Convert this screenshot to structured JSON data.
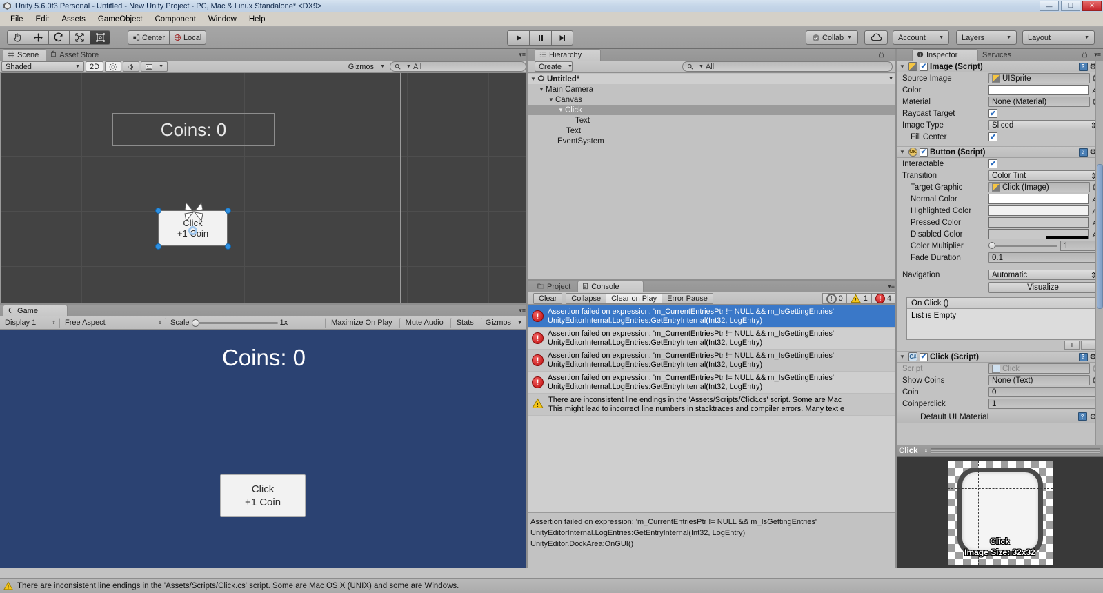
{
  "window": {
    "title": "Unity 5.6.0f3 Personal - Untitled - New Unity Project - PC, Mac & Linux Standalone* <DX9>",
    "app_icon": "unity-icon",
    "minimize": "—",
    "maximize": "❐",
    "close": "✕"
  },
  "menubar": {
    "items": [
      "File",
      "Edit",
      "Assets",
      "GameObject",
      "Component",
      "Window",
      "Help"
    ]
  },
  "toolbar": {
    "tools": [
      {
        "name": "hand-tool",
        "icon": "hand-icon",
        "active": false
      },
      {
        "name": "move-tool",
        "icon": "move-icon",
        "active": false
      },
      {
        "name": "rotate-tool",
        "icon": "rotate-icon",
        "active": false
      },
      {
        "name": "scale-tool",
        "icon": "scale-icon",
        "active": false
      },
      {
        "name": "rect-tool",
        "icon": "rect-transform-icon",
        "active": true
      }
    ],
    "pivot_label": "Center",
    "space_label": "Local",
    "play_label": "▶",
    "pause_label": "❙❙",
    "step_label": "▶❙",
    "collab_label": "Collab",
    "cloud_label": "cloud-icon",
    "account_label": "Account",
    "layers_label": "Layers",
    "layout_label": "Layout"
  },
  "scene": {
    "tabs": [
      {
        "label": "Scene",
        "icon": "scene-grid-icon",
        "active": true
      },
      {
        "label": "Asset Store",
        "icon": "store-icon",
        "active": false
      }
    ],
    "draw_mode": "Shaded",
    "mode_2d": "2D",
    "lighting_icon": "sun-icon",
    "audio_icon": "speaker-icon",
    "fx_icon": "image-icon",
    "gizmos_label": "Gizmos",
    "search_placeholder": "All",
    "search_value": "",
    "coins_text": "Coins: 0",
    "button_line1": "Click",
    "button_line2": "+1 Coin"
  },
  "game": {
    "tab_label": "Game",
    "tab_icon": "game-pad-icon",
    "display_label": "Display 1",
    "aspect_label": "Free Aspect",
    "scale_label": "Scale",
    "scale_value": "1x",
    "maximize_label": "Maximize On Play",
    "mute_label": "Mute Audio",
    "stats_label": "Stats",
    "gizmos_label": "Gizmos",
    "coins_text": "Coins: 0",
    "button_line1": "Click",
    "button_line2": "+1 Coin",
    "background_color": "#2b4272"
  },
  "hierarchy": {
    "tab_label": "Hierarchy",
    "tab_icon": "hierarchy-icon",
    "create_label": "Create",
    "search_placeholder": "All",
    "search_value": "",
    "lock_icon": "lock-icon",
    "menu_icon": "panel-menu-icon",
    "items": [
      {
        "label": "Untitled*",
        "depth": 0,
        "foldout": "▼",
        "root": true,
        "selected": false,
        "icon": "unity-scene-icon"
      },
      {
        "label": "Main Camera",
        "depth": 1,
        "foldout": "▼",
        "root": false,
        "selected": false
      },
      {
        "label": "Canvas",
        "depth": 2,
        "foldout": "▼",
        "root": false,
        "selected": false
      },
      {
        "label": "Click",
        "depth": 3,
        "foldout": "▼",
        "root": false,
        "selected": true
      },
      {
        "label": "Text",
        "depth": 4,
        "foldout": "",
        "root": false,
        "selected": false
      },
      {
        "label": "Text",
        "depth": 3,
        "foldout": "",
        "root": false,
        "selected": false
      },
      {
        "label": "EventSystem",
        "depth": 2,
        "foldout": "",
        "root": false,
        "selected": false
      }
    ]
  },
  "console": {
    "tabs": [
      {
        "label": "Project",
        "icon": "folder-icon",
        "active": false
      },
      {
        "label": "Console",
        "icon": "console-icon",
        "active": true
      }
    ],
    "buttons": [
      "Clear",
      "Collapse",
      "Clear on Play",
      "Error Pause"
    ],
    "counters": [
      {
        "type": "info",
        "icon": "info-icon",
        "count": "0"
      },
      {
        "type": "warning",
        "icon": "warning-icon",
        "count": "1"
      },
      {
        "type": "error",
        "icon": "error-icon",
        "count": "4"
      }
    ],
    "entries": [
      {
        "type": "error",
        "line1": "Assertion failed on expression: 'm_CurrentEntriesPtr != NULL && m_IsGettingEntries'",
        "line2": "UnityEditorInternal.LogEntries:GetEntryInternal(Int32, LogEntry)",
        "selected": true
      },
      {
        "type": "error",
        "line1": "Assertion failed on expression: 'm_CurrentEntriesPtr != NULL && m_IsGettingEntries'",
        "line2": "UnityEditorInternal.LogEntries:GetEntryInternal(Int32, LogEntry)",
        "selected": false
      },
      {
        "type": "error",
        "line1": "Assertion failed on expression: 'm_CurrentEntriesPtr != NULL && m_IsGettingEntries'",
        "line2": "UnityEditorInternal.LogEntries:GetEntryInternal(Int32, LogEntry)",
        "selected": false
      },
      {
        "type": "error",
        "line1": "Assertion failed on expression: 'm_CurrentEntriesPtr != NULL && m_IsGettingEntries'",
        "line2": "UnityEditorInternal.LogEntries:GetEntryInternal(Int32, LogEntry)",
        "selected": false
      },
      {
        "type": "warning",
        "line1": "There are inconsistent line endings in the 'Assets/Scripts/Click.cs' script. Some are Mac ",
        "line2": "This might lead to incorrect line numbers in stacktraces and compiler errors. Many text e",
        "selected": false
      }
    ],
    "detail": "Assertion failed on expression: 'm_CurrentEntriesPtr != NULL && m_IsGettingEntries'\nUnityEditorInternal.LogEntries:GetEntryInternal(Int32, LogEntry)\nUnityEditor.DockArea:OnGUI()"
  },
  "inspector": {
    "tabs": [
      {
        "label": "Inspector",
        "icon": "info-circle-icon",
        "active": true
      },
      {
        "label": "Services",
        "icon": "services-icon",
        "active": false
      }
    ],
    "lock_icon": "lock-icon",
    "menu_icon": "panel-menu-icon",
    "components": [
      {
        "title": "Image (Script)",
        "icon": "image-component-icon",
        "enabled": true,
        "rows": [
          {
            "label": "Source Image",
            "type": "object",
            "value": "UISprite"
          },
          {
            "label": "Color",
            "type": "color",
            "value": "#FFFFFF"
          },
          {
            "label": "Material",
            "type": "object",
            "value": "None (Material)"
          },
          {
            "label": "Raycast Target",
            "type": "checkbox",
            "value": true
          },
          {
            "label": "Image Type",
            "type": "popup",
            "value": "Sliced"
          },
          {
            "label": "Fill Center",
            "type": "checkbox",
            "value": true,
            "indent": true
          }
        ]
      },
      {
        "title": "Button (Script)",
        "icon": "ok-icon",
        "enabled": true,
        "rows": [
          {
            "label": "Interactable",
            "type": "checkbox",
            "value": true
          },
          {
            "label": "Transition",
            "type": "popup",
            "value": "Color Tint"
          },
          {
            "label": "Target Graphic",
            "type": "object",
            "value": "Click (Image)",
            "indent": true
          },
          {
            "label": "Normal Color",
            "type": "color",
            "value": "#FFFFFF",
            "indent": true
          },
          {
            "label": "Highlighted Color",
            "type": "color",
            "value": "#F5F5F5",
            "indent": true
          },
          {
            "label": "Pressed Color",
            "type": "color",
            "value": "#C8C8C8",
            "indent": true
          },
          {
            "label": "Disabled Color",
            "type": "color-alpha",
            "value": "#C8C8C8",
            "indent": true
          },
          {
            "label": "Color Multiplier",
            "type": "slider",
            "value": "1",
            "indent": true
          },
          {
            "label": "Fade Duration",
            "type": "text",
            "value": "0.1",
            "indent": true
          },
          {
            "label": "Navigation",
            "type": "popup",
            "value": "Automatic"
          }
        ],
        "visualize_label": "Visualize",
        "event_title": "On Click ()",
        "event_empty": "List is Empty",
        "plus_label": "+",
        "minus_label": "−"
      },
      {
        "title": "Click (Script)",
        "icon": "cs-script-icon",
        "enabled": true,
        "rows": [
          {
            "label": "Script",
            "type": "object",
            "value": "Click",
            "dim": true
          },
          {
            "label": "Show Coins",
            "type": "object",
            "value": "None (Text)"
          },
          {
            "label": "Coin",
            "type": "text",
            "value": "0"
          },
          {
            "label": "Coinperclick",
            "type": "text",
            "value": "1"
          }
        ]
      }
    ],
    "material_title": "Default UI Material"
  },
  "preview": {
    "name": "Click",
    "label_line1": "Click",
    "label_line2": "Image Size: 32x32"
  },
  "statusbar": {
    "icon": "warning-icon",
    "text": "There are inconsistent line endings in the 'Assets/Scripts/Click.cs' script. Some are Mac OS X (UNIX) and some are Windows."
  }
}
